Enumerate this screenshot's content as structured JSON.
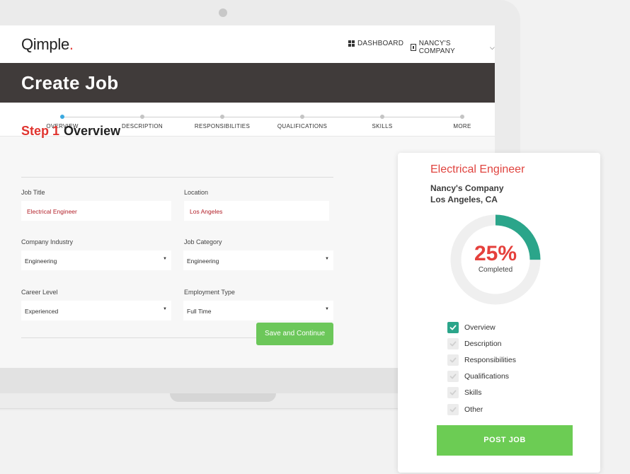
{
  "app": {
    "logo_text": "Qimple",
    "logo_dot": ".",
    "nav": {
      "dashboard_label": "DASHBOARD",
      "company_label": "NANCY'S COMPANY"
    }
  },
  "page": {
    "title": "Create Job"
  },
  "steps": [
    {
      "label": "OVERVIEW",
      "active": true
    },
    {
      "label": "DESCRIPTION",
      "active": false
    },
    {
      "label": "RESPONSIBILITIES",
      "active": false
    },
    {
      "label": "QUALIFICATIONS",
      "active": false
    },
    {
      "label": "SKILLS",
      "active": false
    },
    {
      "label": "MORE",
      "active": false
    }
  ],
  "form": {
    "step_number": "Step 1",
    "step_name": "Overview",
    "job_title": {
      "label": "Job Title",
      "value": "Electrical Engineer"
    },
    "location": {
      "label": "Location",
      "value": "Los Angeles"
    },
    "company_industry": {
      "label": "Company Industry",
      "value": "Engineering"
    },
    "job_category": {
      "label": "Job Category",
      "value": "Engineering"
    },
    "career_level": {
      "label": "Career Level",
      "value": "Experienced"
    },
    "employment_type": {
      "label": "Employment Type",
      "value": "Full Time"
    },
    "save_label": "Save and Continue"
  },
  "summary": {
    "job_title": "Electrical Engineer",
    "company": "Nancy's Company",
    "location": "Los Angeles, CA",
    "progress_percent": 25,
    "progress_text": "25%",
    "progress_label": "Completed",
    "checklist": [
      {
        "label": "Overview",
        "done": true
      },
      {
        "label": "Description",
        "done": false
      },
      {
        "label": "Responsibilities",
        "done": false
      },
      {
        "label": "Qualifications",
        "done": false
      },
      {
        "label": "Skills",
        "done": false
      },
      {
        "label": "Other",
        "done": false
      }
    ],
    "post_label": "POST JOB"
  },
  "colors": {
    "accent_red": "#e5403c",
    "progress_teal": "#2ba58a",
    "button_green": "#6ccc54",
    "header_dark": "#403b3a",
    "active_step_blue": "#3aa9e0"
  }
}
